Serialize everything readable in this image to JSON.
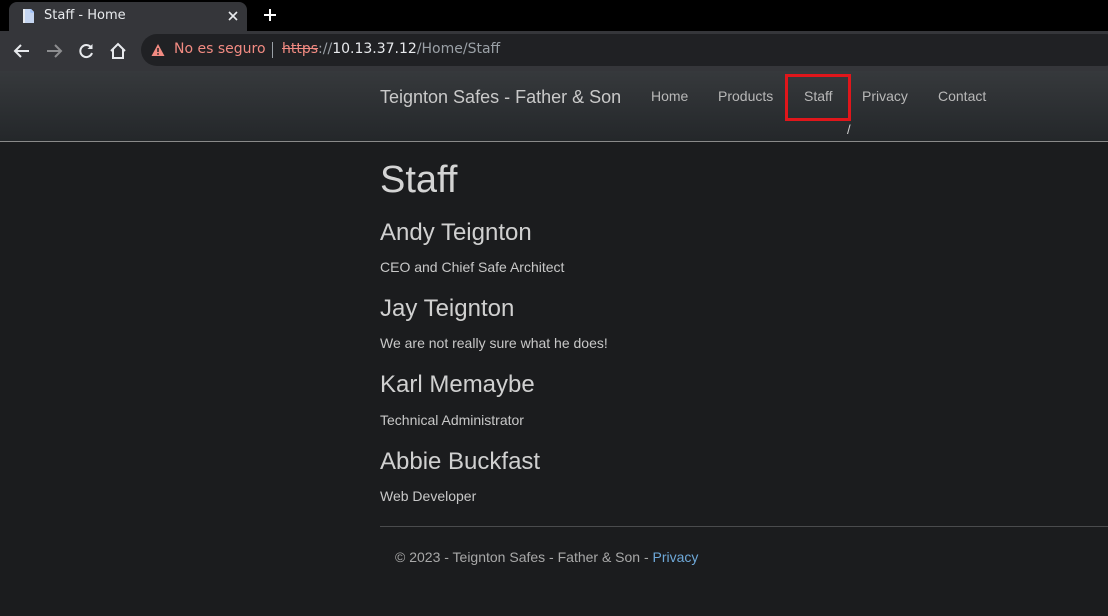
{
  "browser": {
    "tab_title": "Staff - Home",
    "insecure_label": "No es seguro",
    "url_scheme": "https",
    "url_separator": "://",
    "url_host": "10.13.37.12",
    "url_path": "/Home/Staff",
    "icons": [
      "page-favicon-icon",
      "close-icon",
      "plus-icon",
      "back-arrow-icon",
      "forward-arrow-icon",
      "reload-icon",
      "home-icon",
      "warning-icon"
    ]
  },
  "site": {
    "brand": "Teignton Safes - Father & Son",
    "nav": [
      {
        "label": "Home"
      },
      {
        "label": "Products"
      },
      {
        "label": "Staff"
      },
      {
        "label": "Privacy"
      },
      {
        "label": "Contact"
      }
    ],
    "active_nav": "Staff",
    "highlight_color": "#e0161b",
    "stray_text": "/"
  },
  "main": {
    "title": "Staff",
    "staff": [
      {
        "name": "Andy Teignton",
        "role": "CEO and Chief Safe Architect"
      },
      {
        "name": "Jay Teignton",
        "role": "We are not really sure what he does!"
      },
      {
        "name": "Karl Memaybe",
        "role": "Technical Administrator"
      },
      {
        "name": "Abbie Buckfast",
        "role": "Web Developer"
      }
    ]
  },
  "footer": {
    "text": "© 2023 - Teignton Safes - Father & Son - ",
    "link": "Privacy",
    "link_color": "#6ea8d8"
  }
}
